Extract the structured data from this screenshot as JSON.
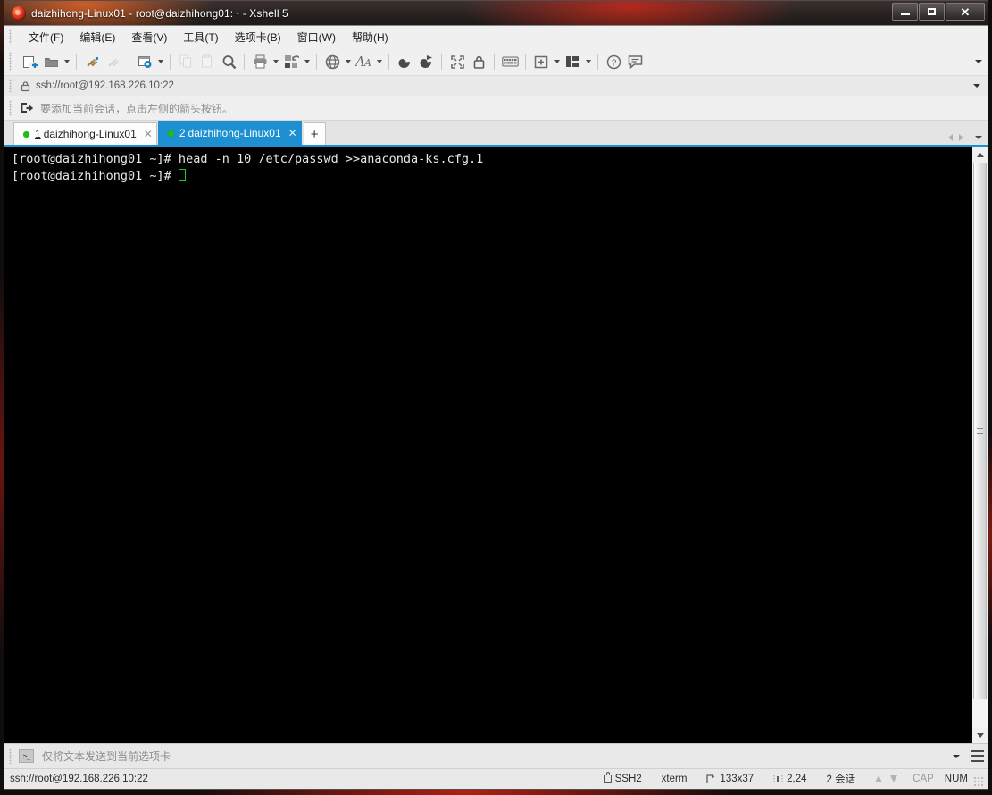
{
  "window": {
    "title": "daizhihong-Linux01 - root@daizhihong01:~ - Xshell 5",
    "logo_icon": "xshell-logo-icon",
    "minimize_label": "",
    "maximize_label": "",
    "close_label": "✕"
  },
  "menubar": {
    "items": [
      {
        "label": "文件(F)",
        "name": "menu-file"
      },
      {
        "label": "编辑(E)",
        "name": "menu-edit"
      },
      {
        "label": "查看(V)",
        "name": "menu-view"
      },
      {
        "label": "工具(T)",
        "name": "menu-tools"
      },
      {
        "label": "选项卡(B)",
        "name": "menu-tabs"
      },
      {
        "label": "窗口(W)",
        "name": "menu-window"
      },
      {
        "label": "帮助(H)",
        "name": "menu-help"
      }
    ]
  },
  "toolbar": {
    "buttons": [
      {
        "name": "new-session-icon",
        "icon": "new-file"
      },
      {
        "name": "open-folder-icon",
        "icon": "folder",
        "caret": true
      },
      {
        "name": "sep1",
        "icon": "separator"
      },
      {
        "name": "connect-icon",
        "icon": "plug-connect"
      },
      {
        "name": "disconnect-icon",
        "icon": "plug-disconnect",
        "disabled": true
      },
      {
        "name": "sep2",
        "icon": "separator"
      },
      {
        "name": "properties-icon",
        "icon": "gear-window",
        "caret": true
      },
      {
        "name": "sep3",
        "icon": "separator"
      },
      {
        "name": "copy-icon",
        "icon": "copy",
        "disabled": true
      },
      {
        "name": "paste-icon",
        "icon": "paste",
        "disabled": true
      },
      {
        "name": "find-icon",
        "icon": "magnifier"
      },
      {
        "name": "sep4",
        "icon": "separator"
      },
      {
        "name": "print-icon",
        "icon": "printer",
        "caret": true
      },
      {
        "name": "transfer-icon",
        "icon": "file-transfer",
        "caret": true
      },
      {
        "name": "sep5",
        "icon": "separator"
      },
      {
        "name": "globe-icon",
        "icon": "globe",
        "caret": true
      },
      {
        "name": "font-icon",
        "icon": "font-A",
        "caret": true
      },
      {
        "name": "sep6",
        "icon": "separator"
      },
      {
        "name": "log-icon",
        "icon": "swirl-dark"
      },
      {
        "name": "record-icon",
        "icon": "swirl-flag"
      },
      {
        "name": "sep7",
        "icon": "separator"
      },
      {
        "name": "fullscreen-icon",
        "icon": "expand-arrows"
      },
      {
        "name": "lock-icon",
        "icon": "padlock"
      },
      {
        "name": "sep8",
        "icon": "separator"
      },
      {
        "name": "keyboard-icon",
        "icon": "keyboard"
      },
      {
        "name": "sep9",
        "icon": "separator"
      },
      {
        "name": "add-layout-icon",
        "icon": "add-box",
        "caret": true
      },
      {
        "name": "arrange-layout-icon",
        "icon": "layout-columns",
        "caret": true
      },
      {
        "name": "sep10",
        "icon": "separator"
      },
      {
        "name": "help-icon",
        "icon": "question-circle"
      },
      {
        "name": "feedback-icon",
        "icon": "speech-bubble"
      }
    ],
    "overflow_caret": "toolbar-overflow-caret"
  },
  "addressbar": {
    "lock_icon": "lock-icon",
    "url": "ssh://root@192.168.226.10:22",
    "caret": "address-dropdown-caret"
  },
  "sessionbar": {
    "icon": "add-session-arrow-icon",
    "hint": "要添加当前会话，点击左侧的箭头按钮。"
  },
  "tabs": {
    "items": [
      {
        "num": "1",
        "label": "daizhihong-Linux01",
        "active": false,
        "status": "connected",
        "close": "✕"
      },
      {
        "num": "2",
        "label": "daizhihong-Linux01",
        "active": true,
        "status": "connected",
        "close": "✕"
      }
    ],
    "new_tab_label": "+",
    "nav_prev": "tab-prev-arrow",
    "nav_next": "tab-next-arrow",
    "nav_list": "tab-list-caret"
  },
  "terminal": {
    "lines": [
      "[root@daizhihong01 ~]# head -n 10 /etc/passwd >>anaconda-ks.cfg.1",
      "[root@daizhihong01 ~]# "
    ],
    "cursor": "block-cursor",
    "bg_color": "#000000",
    "fg_color": "#e8e8e8",
    "cursor_color": "#1ecb1e"
  },
  "scrollbar": {
    "up_arrow": "scroll-up-arrow",
    "down_arrow": "scroll-down-arrow",
    "thumb": "scroll-thumb"
  },
  "sendbar": {
    "icon": "terminal-prompt-icon",
    "label": "仅将文本发送到当前选项卡",
    "caret": "sendbar-dropdown-caret",
    "menu": "sendbar-menu-icon"
  },
  "statusbar": {
    "url": "ssh://root@192.168.226.10:22",
    "cells": [
      {
        "name": "protocol",
        "icon": "lock-icon",
        "text": "SSH2"
      },
      {
        "name": "terminal-type",
        "icon": "",
        "text": "xterm"
      },
      {
        "name": "terminal-size",
        "icon": "size-icon",
        "text": "133x37"
      },
      {
        "name": "cursor-position",
        "icon": "column-icon",
        "text": "2,24"
      },
      {
        "name": "session-count",
        "icon": "",
        "text": "2 会话"
      }
    ],
    "upload_icon": "arrow-up-icon",
    "download_icon": "arrow-down-icon",
    "caps": "CAP",
    "num": "NUM"
  },
  "colors": {
    "accent": "#1e90d2",
    "tab_active_bg": "#1e90d2",
    "status_dot": "#18c018",
    "chrome_bg": "#f0f0f0",
    "terminal_bg": "#000000"
  }
}
